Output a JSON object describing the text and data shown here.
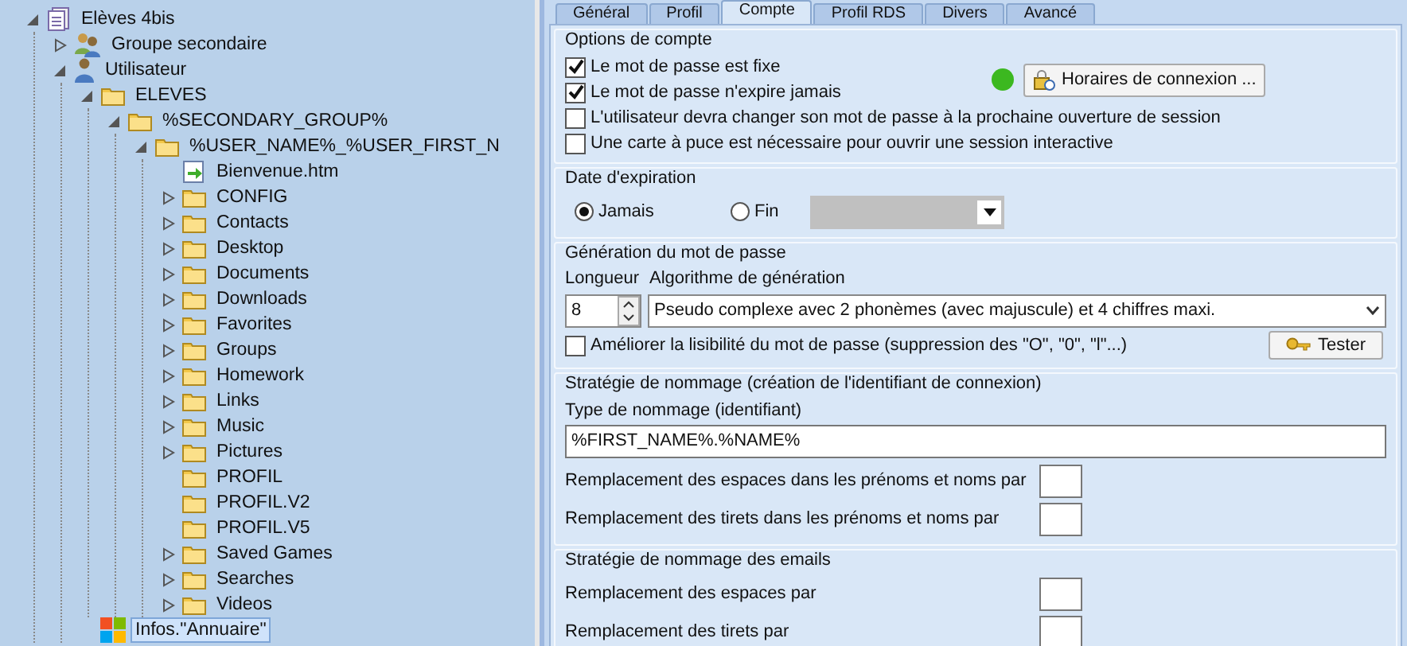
{
  "tree": [
    {
      "label": "Elèves 4bis",
      "kind": "document",
      "expanded": true,
      "selected": false,
      "children": [
        {
          "label": "Groupe secondaire",
          "kind": "group",
          "expanded": false,
          "selected": false
        },
        {
          "label": "Utilisateur",
          "kind": "user",
          "expanded": true,
          "selected": false,
          "children": [
            {
              "label": "ELEVES",
              "kind": "folder",
              "expanded": true,
              "selected": false,
              "children": [
                {
                  "label": "%SECONDARY_GROUP%",
                  "kind": "folder",
                  "expanded": true,
                  "selected": false,
                  "children": [
                    {
                      "label": "%USER_NAME%_%USER_FIRST_N",
                      "kind": "folder",
                      "expanded": true,
                      "selected": false,
                      "children": [
                        {
                          "label": "Bienvenue.htm",
                          "kind": "file",
                          "selected": false
                        },
                        {
                          "label": "CONFIG",
                          "kind": "folder",
                          "expanded": false,
                          "selected": false
                        },
                        {
                          "label": "Contacts",
                          "kind": "folder",
                          "expanded": false,
                          "selected": false
                        },
                        {
                          "label": "Desktop",
                          "kind": "folder",
                          "expanded": false,
                          "selected": false
                        },
                        {
                          "label": "Documents",
                          "kind": "folder",
                          "expanded": false,
                          "selected": false
                        },
                        {
                          "label": "Downloads",
                          "kind": "folder",
                          "expanded": false,
                          "selected": false
                        },
                        {
                          "label": "Favorites",
                          "kind": "folder",
                          "expanded": false,
                          "selected": false
                        },
                        {
                          "label": "Groups",
                          "kind": "folder",
                          "expanded": false,
                          "selected": false
                        },
                        {
                          "label": "Homework",
                          "kind": "folder",
                          "expanded": false,
                          "selected": false
                        },
                        {
                          "label": "Links",
                          "kind": "folder",
                          "expanded": false,
                          "selected": false
                        },
                        {
                          "label": "Music",
                          "kind": "folder",
                          "expanded": false,
                          "selected": false
                        },
                        {
                          "label": "Pictures",
                          "kind": "folder",
                          "expanded": false,
                          "selected": false
                        },
                        {
                          "label": "PROFIL",
                          "kind": "folder",
                          "selected": false
                        },
                        {
                          "label": "PROFIL.V2",
                          "kind": "folder",
                          "selected": false
                        },
                        {
                          "label": "PROFIL.V5",
                          "kind": "folder",
                          "selected": false
                        },
                        {
                          "label": "Saved Games",
                          "kind": "folder",
                          "expanded": false,
                          "selected": false
                        },
                        {
                          "label": "Searches",
                          "kind": "folder",
                          "expanded": false,
                          "selected": false
                        },
                        {
                          "label": "Videos",
                          "kind": "folder",
                          "expanded": false,
                          "selected": false
                        }
                      ]
                    }
                  ]
                }
              ]
            },
            {
              "label": "Infos.\"Annuaire\"",
              "kind": "windows",
              "selected": true
            }
          ]
        }
      ]
    }
  ],
  "tabs": [
    {
      "label": "Général",
      "selected": false
    },
    {
      "label": "Profil",
      "selected": false
    },
    {
      "label": "Compte",
      "selected": true
    },
    {
      "label": "Profil RDS",
      "selected": false
    },
    {
      "label": "Divers",
      "selected": false
    },
    {
      "label": "Avancé",
      "selected": false
    }
  ],
  "account_options": {
    "title": "Options de compte",
    "checkboxes": [
      {
        "label": "Le mot de passe est fixe",
        "checked": true
      },
      {
        "label": "Le mot de passe n'expire jamais",
        "checked": true
      },
      {
        "label": "L'utilisateur devra changer son mot de passe à la prochaine ouverture de session",
        "checked": false
      },
      {
        "label": "Une carte à puce est nécessaire pour ouvrir une session interactive",
        "checked": false
      }
    ],
    "hours_button": "Horaires de connexion ..."
  },
  "expiration": {
    "title": "Date d'expiration",
    "options": [
      {
        "label": "Jamais",
        "selected": true
      },
      {
        "label": "Fin",
        "selected": false
      }
    ],
    "date_disabled": true
  },
  "password_generation": {
    "title": "Génération du mot de passe",
    "length_label": "Longueur",
    "length": "8",
    "algorithm_label": "Algorithme de génération",
    "algorithm": "Pseudo complexe avec 2 phonèmes (avec majuscule) et 4 chiffres maxi.",
    "readability": {
      "label": "Améliorer la lisibilité du mot de passe (suppression des \"O\", \"0\", \"l\"...)",
      "checked": false
    },
    "test_button": "Tester"
  },
  "naming": {
    "title": "Stratégie de nommage (création de l'identifiant de connexion)",
    "type_label": "Type de nommage (identifiant)",
    "type_value": "%FIRST_NAME%.%NAME%",
    "replacements": [
      "Remplacement des espaces dans les prénoms et noms par",
      "Remplacement des tirets dans les prénoms et noms par"
    ]
  },
  "email_naming": {
    "title": "Stratégie de nommage des emails",
    "replacements": [
      "Remplacement des espaces  par",
      "Remplacement des tirets par"
    ]
  }
}
